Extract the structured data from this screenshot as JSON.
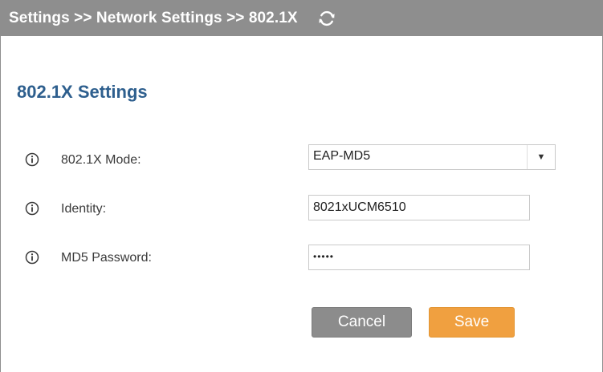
{
  "header": {
    "breadcrumb": "Settings >> Network Settings >> 802.1X",
    "refresh_icon": "refresh-icon"
  },
  "section": {
    "title": "802.1X Settings"
  },
  "form": {
    "mode": {
      "label": "802.1X Mode:",
      "value": "EAP-MD5",
      "icon": "info-icon"
    },
    "identity": {
      "label": "Identity:",
      "value": "8021xUCM6510",
      "icon": "info-icon"
    },
    "password": {
      "label": "MD5 Password:",
      "value": "•••••",
      "icon": "info-icon"
    }
  },
  "actions": {
    "cancel_label": "Cancel",
    "save_label": "Save"
  },
  "colors": {
    "header_bg": "#8e8e8e",
    "title": "#2e5f8e",
    "cancel_bg": "#8c8c8c",
    "save_bg": "#f0a040"
  }
}
